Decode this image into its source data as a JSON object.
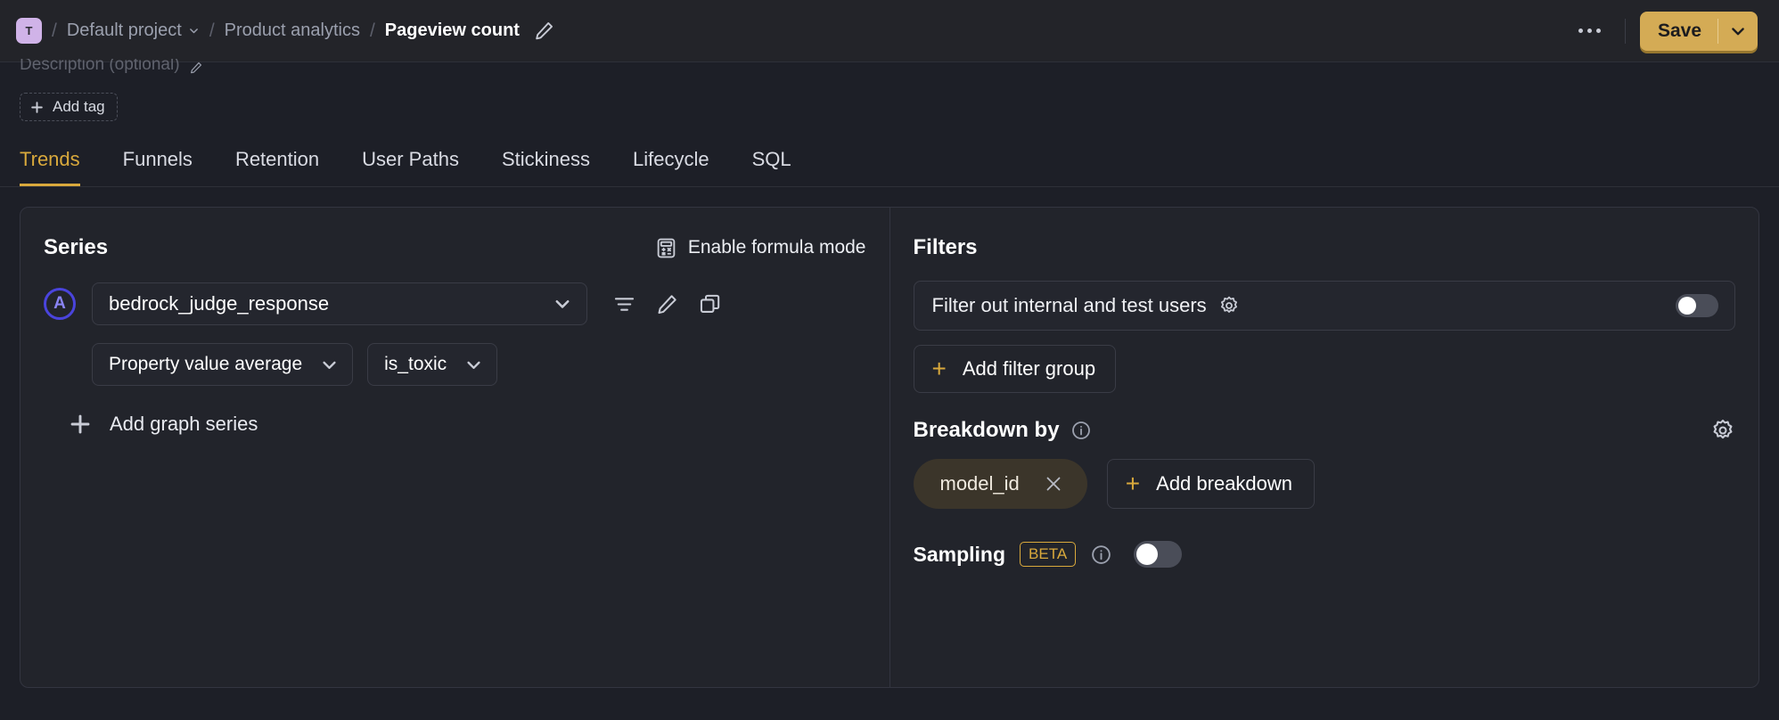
{
  "topbar": {
    "project_initial": "T",
    "crumb_project": "Default project",
    "crumb_section": "Product analytics",
    "crumb_current": "Pageview count",
    "separator": "/",
    "save_label": "Save"
  },
  "subheader": {
    "description_placeholder": "Description (optional)",
    "add_tag_label": "Add tag"
  },
  "tabs": [
    {
      "label": "Trends",
      "active": true
    },
    {
      "label": "Funnels",
      "active": false
    },
    {
      "label": "Retention",
      "active": false
    },
    {
      "label": "User Paths",
      "active": false
    },
    {
      "label": "Stickiness",
      "active": false
    },
    {
      "label": "Lifecycle",
      "active": false
    },
    {
      "label": "SQL",
      "active": false
    }
  ],
  "series": {
    "title": "Series",
    "formula_label": "Enable formula mode",
    "letter": "A",
    "event_name": "bedrock_judge_response",
    "math_label": "Property value average",
    "property_label": "is_toxic",
    "add_series_label": "Add graph series",
    "add_series_plus": "+"
  },
  "filters": {
    "title": "Filters",
    "internal_users_label": "Filter out internal and test users",
    "internal_users_enabled": false,
    "add_filter_group_label": "Add filter group",
    "plus": "+"
  },
  "breakdown": {
    "title": "Breakdown by",
    "tag_label": "model_id",
    "add_label": "Add breakdown",
    "plus": "+"
  },
  "sampling": {
    "label": "Sampling",
    "beta_badge": "BETA",
    "enabled": false
  },
  "colors": {
    "accent_gold": "#d9a93c",
    "save_bg": "#d4ab55",
    "series_badge": "#4a44dd",
    "project_badge": "#d0b3e8",
    "page_bg": "#1d1f27",
    "panel_bg": "#22242b"
  }
}
